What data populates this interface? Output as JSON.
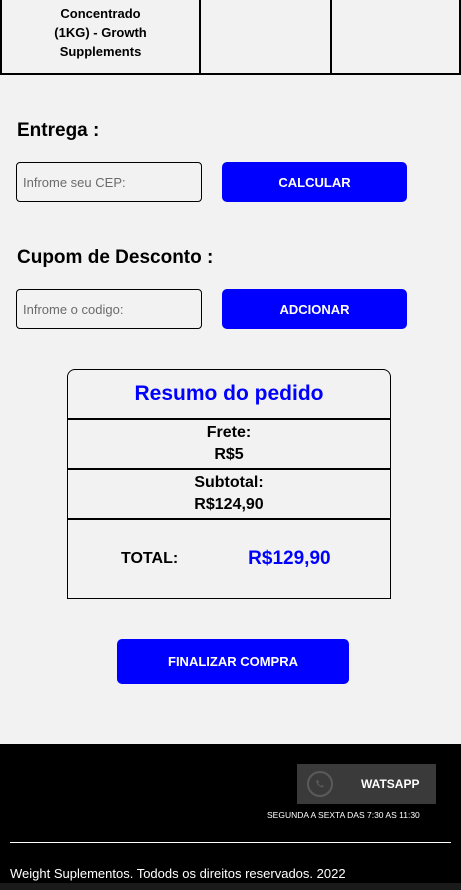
{
  "product": {
    "name": "Concentrado (1KG) - Growth Supplements"
  },
  "shipping": {
    "label": "Entrega :",
    "cep_placeholder": "Infrome seu CEP:",
    "calculate_label": "CALCULAR"
  },
  "coupon": {
    "label": "Cupom de Desconto :",
    "code_placeholder": "Infrome o codigo:",
    "apply_label": "ADCIONAR"
  },
  "summary": {
    "title": "Resumo do pedido",
    "freight_label": "Frete:",
    "freight_value": "R$5",
    "subtotal_label": "Subtotal:",
    "subtotal_value": "R$124,90",
    "total_label": "TOTAL:",
    "total_value": "R$129,90"
  },
  "checkout": {
    "label": "FINALIZAR COMPRA"
  },
  "footer": {
    "whatsapp_label": "WATSAPP",
    "whatsapp_icon": "whatsapp-icon",
    "hours": "SEGUNDA A SEXTA DAS 7:30 AS 11:30",
    "copyright": "Weight Suplementos. Todods os direitos reservados. 2022"
  },
  "colors": {
    "accent": "#0000ff",
    "background": "#f2f2f2",
    "footer": "#000000"
  }
}
